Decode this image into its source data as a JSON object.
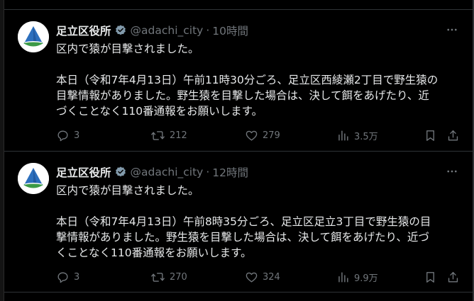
{
  "colors": {
    "background": "#000000",
    "text_primary": "#e7e9ea",
    "text_secondary": "#71767b",
    "divider": "#2f3336",
    "verified_badge": "#829aab",
    "avatar_bg": "#ffffff",
    "avatar_blue": "#2c6fbd",
    "avatar_green": "#3c9a46"
  },
  "icons": {
    "more": "more-horizontal-icon",
    "reply": "reply-icon",
    "retweet": "retweet-icon",
    "like": "heart-icon",
    "views": "views-bar-chart-icon",
    "bookmark": "bookmark-icon",
    "share": "share-icon",
    "verified": "verified-badge-icon"
  },
  "tweets": [
    {
      "display_name": "足立区役所",
      "handle": "@adachi_city",
      "separator": "·",
      "time": "10時間",
      "line1": "区内で猿が目撃されました。",
      "line2": "本日（令和7年4月13日）午前11時30分ごろ、足立区西綾瀬2丁目で野生猿の",
      "line3": "目撃情報がありました。野生猿を目撃した場合は、決して餌をあげたり、近",
      "line4": "づくことなく110番通報をお願いします。",
      "replies": "3",
      "retweets": "212",
      "likes": "279",
      "views": "3.5万"
    },
    {
      "display_name": "足立区役所",
      "handle": "@adachi_city",
      "separator": "·",
      "time": "12時間",
      "line1": "区内で猿が目撃されました。",
      "line2": "本日（令和7年4月13日）午前8時35分ごろ、足立区足立3丁目で野生猿の目",
      "line3": "撃情報がありました。野生猿を目撃した場合は、決して餌をあげたり、近づ",
      "line4": "くことなく110番通報をお願いします。",
      "replies": "3",
      "retweets": "270",
      "likes": "324",
      "views": "9.9万"
    }
  ]
}
